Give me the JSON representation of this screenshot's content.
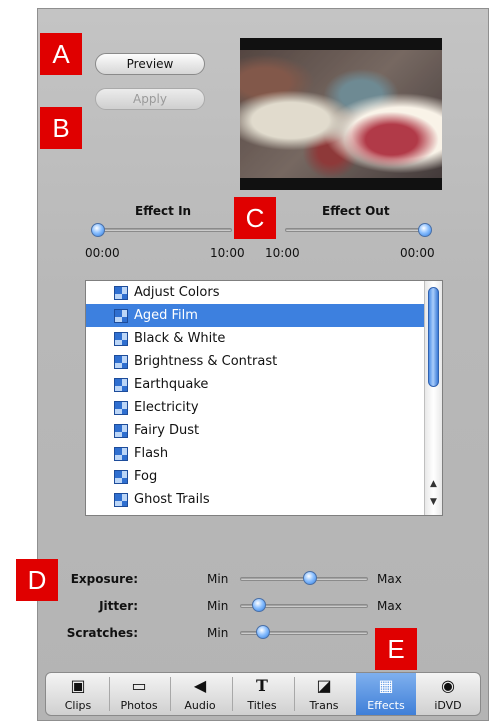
{
  "buttons": {
    "preview": "Preview",
    "apply": "Apply"
  },
  "badges": {
    "a": "A",
    "b": "B",
    "c": "C",
    "d": "D",
    "e": "E"
  },
  "timing": {
    "effect_in_label": "Effect In",
    "effect_out_label": "Effect Out",
    "in_start": "00:00",
    "in_end": "10:00",
    "out_start": "10:00",
    "out_end": "00:00"
  },
  "effects_list": {
    "selected": "Aged Film",
    "items": [
      "Adjust Colors",
      "Aged Film",
      "Black & White",
      "Brightness & Contrast",
      "Earthquake",
      "Electricity",
      "Fairy Dust",
      "Flash",
      "Fog",
      "Ghost Trails"
    ]
  },
  "parameters": [
    {
      "label": "Exposure:",
      "min": "Min",
      "max": "Max",
      "value": 0.55
    },
    {
      "label": "Jitter:",
      "min": "Min",
      "max": "Max",
      "value": 0.15
    },
    {
      "label": "Scratches:",
      "min": "Min",
      "max": "",
      "value": 0.18
    }
  ],
  "tabs": [
    {
      "label": "Clips",
      "icon": "clips-icon",
      "glyph": "▣"
    },
    {
      "label": "Photos",
      "icon": "photos-icon",
      "glyph": "▭"
    },
    {
      "label": "Audio",
      "icon": "audio-icon",
      "glyph": "◀"
    },
    {
      "label": "Titles",
      "icon": "titles-icon",
      "glyph": "T"
    },
    {
      "label": "Trans",
      "icon": "transitions-icon",
      "glyph": "◪"
    },
    {
      "label": "Effects",
      "icon": "effects-icon",
      "glyph": "▦",
      "active": true
    },
    {
      "label": "iDVD",
      "icon": "idvd-icon",
      "glyph": "◉"
    }
  ],
  "colors": {
    "accent": "#3d80df",
    "badge": "#e00000"
  }
}
